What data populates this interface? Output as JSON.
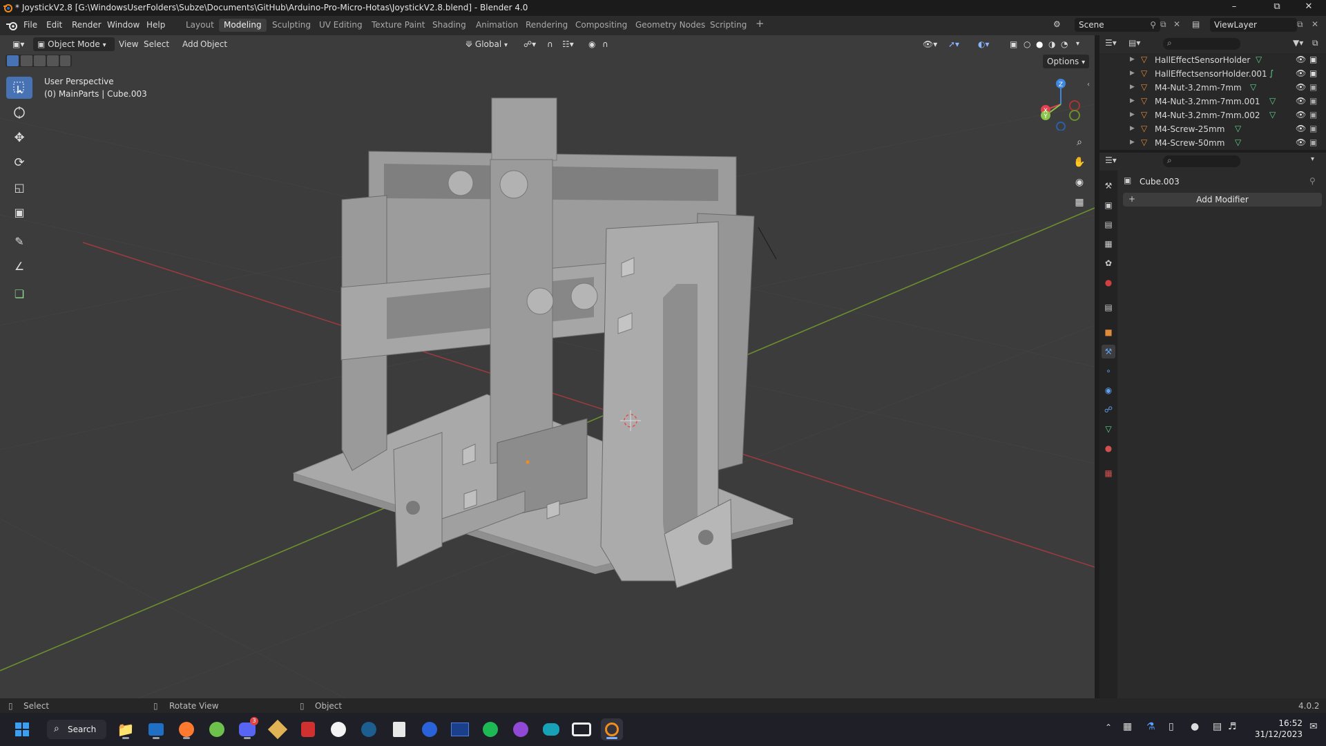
{
  "window": {
    "title": "* JoystickV2.8 [G:\\WindowsUserFolders\\Subze\\Documents\\GitHub\\Arduino-Pro-Micro-Hotas\\JoystickV2.8.blend] - Blender 4.0"
  },
  "menus": [
    "File",
    "Edit",
    "Render",
    "Window",
    "Help"
  ],
  "workspaces": [
    "Layout",
    "Modeling",
    "Sculpting",
    "UV Editing",
    "Texture Paint",
    "Shading",
    "Animation",
    "Rendering",
    "Compositing",
    "Geometry Nodes",
    "Scripting"
  ],
  "active_workspace": "Modeling",
  "scene": {
    "name": "Scene",
    "view_layer": "ViewLayer"
  },
  "viewport": {
    "mode": "Object Mode",
    "menus": [
      "View",
      "Select",
      "Add",
      "Object"
    ],
    "transform_orientation": "Global",
    "options_label": "Options",
    "overlay_line1": "User Perspective",
    "overlay_line2": "(0) MainParts | Cube.003",
    "gizmo_axes": [
      "Z",
      "X",
      "Y"
    ]
  },
  "outliner": {
    "items": [
      "HallEffectSensorHolder",
      "HallEffectsensorHolder.001",
      "M4-Nut-3.2mm-7mm",
      "M4-Nut-3.2mm-7mm.001",
      "M4-Nut-3.2mm-7mm.002",
      "M4-Screw-25mm",
      "M4-Screw-50mm"
    ]
  },
  "properties": {
    "object_name": "Cube.003",
    "add_modifier_label": "Add Modifier"
  },
  "statusbar": {
    "select": "Select",
    "rotate": "Rotate View",
    "object": "Object",
    "version": "4.0.2"
  },
  "taskbar": {
    "search_label": "Search",
    "time": "16:52",
    "date": "31/12/2023",
    "discord_badge": "3"
  },
  "colors": {
    "accent": "#4772b3",
    "mesh_icon": "#e08a3c",
    "data_icon": "#5fd38d",
    "x_axis": "#e0424f",
    "y_axis": "#8bc34a",
    "z_axis": "#3f86e0"
  }
}
